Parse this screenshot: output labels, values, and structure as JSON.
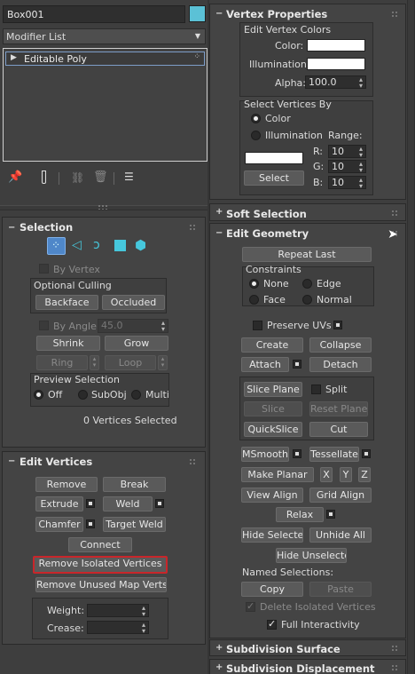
{
  "object": {
    "name": "Box001",
    "color": "#5bc1d6"
  },
  "modifier_list": {
    "label": "Modifier List"
  },
  "stack": {
    "item": "Editable Poly"
  },
  "selection": {
    "title": "Selection",
    "by_vertex": "By Vertex",
    "optional_culling": "Optional Culling",
    "backface": "Backface",
    "occluded": "Occluded",
    "by_angle": "By Angle:",
    "angle_value": "45.0",
    "shrink": "Shrink",
    "grow": "Grow",
    "ring": "Ring",
    "loop": "Loop",
    "preview_selection": "Preview Selection",
    "off": "Off",
    "subobj": "SubObj",
    "multi": "Multi",
    "status": "0 Vertices Selected"
  },
  "edit_vertices": {
    "title": "Edit Vertices",
    "remove": "Remove",
    "break": "Break",
    "extrude": "Extrude",
    "weld": "Weld",
    "chamfer": "Chamfer",
    "target_weld": "Target Weld",
    "connect": "Connect",
    "remove_isolated": "Remove Isolated Vertices",
    "remove_unused": "Remove Unused Map Verts",
    "weight": "Weight:",
    "crease": "Crease:"
  },
  "vertex_properties": {
    "title": "Vertex Properties",
    "edit_vertex_colors": "Edit Vertex Colors",
    "color": "Color:",
    "illumination": "Illumination:",
    "alpha": "Alpha:",
    "alpha_value": "100.0",
    "select_by": "Select Vertices By",
    "radio_color": "Color",
    "radio_illumination": "Illumination",
    "range": "Range:",
    "r": "R:",
    "g": "G:",
    "b": "B:",
    "r_value": "10",
    "g_value": "10",
    "b_value": "10",
    "select": "Select"
  },
  "soft_selection": {
    "title": "Soft Selection"
  },
  "edit_geometry": {
    "title": "Edit Geometry",
    "repeat_last": "Repeat Last",
    "constraints": "Constraints",
    "none": "None",
    "edge": "Edge",
    "face": "Face",
    "normal": "Normal",
    "preserve_uvs": "Preserve UVs",
    "create": "Create",
    "collapse": "Collapse",
    "attach": "Attach",
    "detach": "Detach",
    "slice_plane": "Slice Plane",
    "split": "Split",
    "slice": "Slice",
    "reset_plane": "Reset Plane",
    "quickslice": "QuickSlice",
    "cut": "Cut",
    "msmooth": "MSmooth",
    "tessellate": "Tessellate",
    "make_planar": "Make Planar",
    "x": "X",
    "y": "Y",
    "z": "Z",
    "view_align": "View Align",
    "grid_align": "Grid Align",
    "relax": "Relax",
    "hide_selected": "Hide Selected",
    "unhide_all": "Unhide All",
    "hide_unselected": "Hide Unselected",
    "named_selections": "Named Selections:",
    "copy": "Copy",
    "paste": "Paste",
    "delete_isolated": "Delete Isolated Vertices",
    "full_interactivity": "Full Interactivity"
  },
  "subdivision_surface": {
    "title": "Subdivision Surface"
  },
  "subdivision_displacement": {
    "title": "Subdivision Displacement"
  }
}
